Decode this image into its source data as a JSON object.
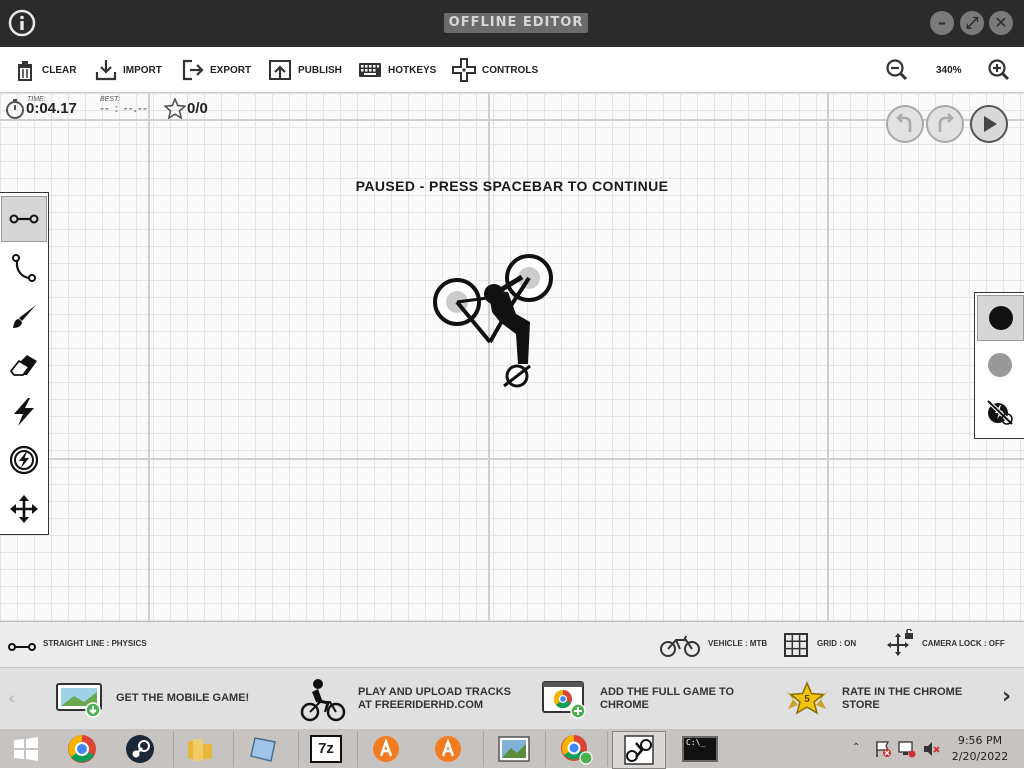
{
  "window": {
    "title": "OFFLINE EDITOR",
    "controls": {
      "minimize": "–",
      "maximize": "⤢",
      "close": "✕"
    }
  },
  "toolbar": {
    "clear": "CLEAR",
    "import": "IMPORT",
    "export": "EXPORT",
    "publish": "PUBLISH",
    "hotkeys": "HOTKEYS",
    "controls": "CONTROLS",
    "zoom": "340%"
  },
  "hud": {
    "time_caption": "TIME:",
    "time": "0:04.17",
    "best_caption": "BEST:",
    "best": "-- : --.--",
    "stars": "0/0",
    "paused_message": "PAUSED - PRESS SPACEBAR TO CONTINUE"
  },
  "left_tools": [
    "straight-line-icon",
    "curve-icon",
    "brush-icon",
    "eraser-icon",
    "boost-icon",
    "slowmo-icon",
    "move-icon"
  ],
  "right_tools": [
    "black-line-color",
    "gray-line-color",
    "powerup-toggle"
  ],
  "status": {
    "line_mode": "STRAIGHT LINE : PHYSICS",
    "vehicle": "VEHICLE : MTB",
    "grid": "GRID : ON",
    "camera": "CAMERA LOCK : OFF"
  },
  "promos": {
    "mobile": "GET THE MOBILE GAME!",
    "upload_line1": "PLAY AND UPLOAD TRACKS",
    "upload_line2": "AT FREERIDERHD.COM",
    "full_line1": "ADD THE FULL GAME TO",
    "full_line2": "CHROME",
    "rate_line1": "RATE IN THE CHROME",
    "rate_line2": "STORE",
    "rate_badge": "5"
  },
  "taskbar": {
    "items": [
      "windows-start",
      "chrome",
      "steam",
      "file-explorer",
      "tablet-app",
      "7zip",
      "avast-1",
      "avast-2",
      "photos",
      "chrome-profile",
      "freerider",
      "command-prompt"
    ],
    "seven_zip_label": "7z",
    "cmd_label": "C:\\_",
    "time": "9:56 PM",
    "date": "2/20/2022"
  },
  "colors": {
    "titlebar": "#2b2b2b",
    "accent_gray": "#6b6b6b",
    "grid_line": "#e4e4e4",
    "panel_border": "#333333"
  }
}
